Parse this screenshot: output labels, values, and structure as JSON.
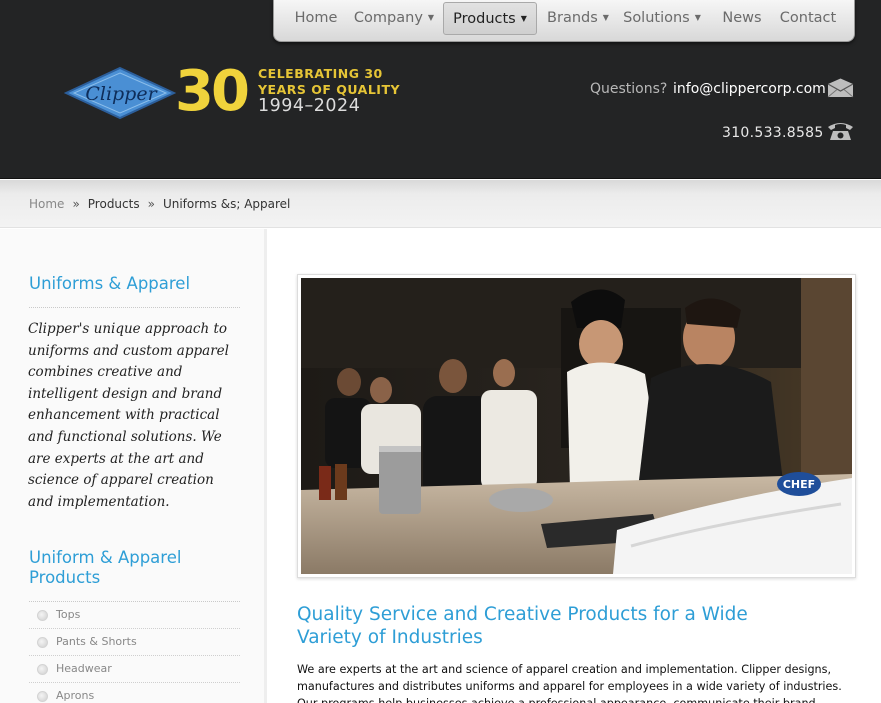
{
  "nav": {
    "items": [
      {
        "label": "Home",
        "caret": ""
      },
      {
        "label": "Company",
        "caret": "▼"
      },
      {
        "label": "Products",
        "caret": "▼",
        "active": true
      },
      {
        "label": "Brands",
        "caret": "▼"
      },
      {
        "label": "Solutions",
        "caret": "▼"
      },
      {
        "label": "News",
        "caret": ""
      },
      {
        "label": "Contact",
        "caret": ""
      }
    ]
  },
  "logo": {
    "brand": "Clipper",
    "anniversary_number": "30",
    "celebrating": "CELEBRATING 30 YEARS OF QUALITY",
    "years": "1994–2024"
  },
  "contact": {
    "questions_label": "Questions?",
    "email": "info@clippercorp.com",
    "phone": "310.533.8585",
    "email_icon": "envelope-icon",
    "phone_icon": "telephone-icon"
  },
  "breadcrumb": {
    "home": "Home",
    "separator": "»",
    "products": "Products",
    "current": "Uniforms &s; Apparel"
  },
  "sidebar": {
    "heading": "Uniforms & Apparel",
    "description": "Clipper's unique approach to uniforms and custom apparel combines creative and intelligent design and brand enhancement with practical and functional solutions. We are experts at the art and science of apparel creation and implementation.",
    "products_heading": "Uniform & Apparel Products",
    "items": [
      {
        "label": "Tops"
      },
      {
        "label": "Pants & Shorts"
      },
      {
        "label": "Headwear"
      },
      {
        "label": "Aprons"
      }
    ]
  },
  "main": {
    "hero_badge": "CHEF",
    "heading": "Quality Service and Creative Products for a Wide Variety of Industries",
    "body": "We are experts at the art and science of apparel creation and implementation. Clipper designs, manufactures and distributes uniforms and apparel for employees in a wide variety of industries. Our programs help businesses achieve a professional appearance, communicate their brand promise and"
  },
  "colors": {
    "header_bg": "#232425",
    "accent_blue": "#2e9ed6",
    "logo_gold": "#f0d33c",
    "logo_diamond": "#4a8fd4"
  }
}
